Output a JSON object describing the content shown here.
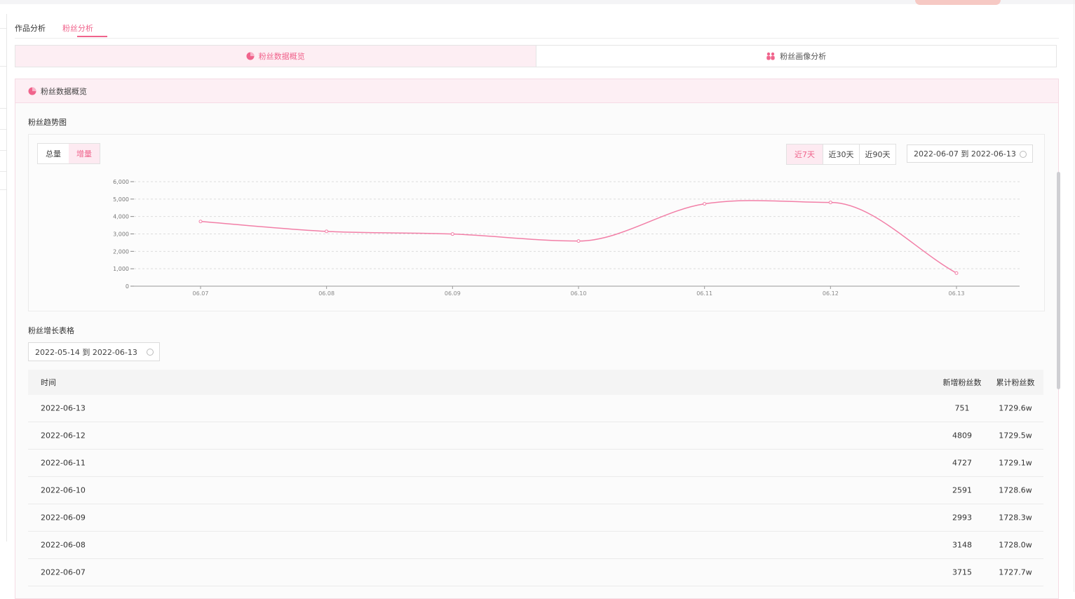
{
  "tabs": [
    {
      "label": "作品分析",
      "active": false
    },
    {
      "label": "粉丝分析",
      "active": true
    }
  ],
  "segment": [
    {
      "label": "粉丝数据概览",
      "icon": "pie-chart-icon",
      "active": true
    },
    {
      "label": "粉丝画像分析",
      "icon": "people-icon",
      "active": false
    }
  ],
  "panel": {
    "title": "粉丝数据概览",
    "icon": "pie-chart-icon"
  },
  "trend": {
    "title": "粉丝趋势图",
    "toggle": [
      {
        "label": "总量",
        "active": false
      },
      {
        "label": "增量",
        "active": true
      }
    ],
    "ranges": [
      {
        "label": "近7天",
        "active": true
      },
      {
        "label": "近30天",
        "active": false
      },
      {
        "label": "近90天",
        "active": false
      }
    ],
    "date_range": "2022-06-07 到 2022-06-13"
  },
  "chart_data": {
    "type": "line",
    "categories": [
      "06.07",
      "06.08",
      "06.09",
      "06.10",
      "06.11",
      "06.12",
      "06.13"
    ],
    "values": [
      3715,
      3148,
      2993,
      2591,
      4727,
      4809,
      751
    ],
    "ylim": [
      0,
      6000
    ],
    "yticks": [
      "6,000",
      "5,000",
      "4,000",
      "3,000",
      "2,000",
      "1,000",
      "0"
    ],
    "grid": true,
    "color": "#f27fa7"
  },
  "growth": {
    "title": "粉丝增长表格",
    "date_range": "2022-05-14 到 2022-06-13",
    "columns": [
      "时间",
      "新增粉丝数",
      "累计粉丝数"
    ],
    "rows": [
      {
        "date": "2022-06-13",
        "new": "751",
        "total": "1729.6w"
      },
      {
        "date": "2022-06-12",
        "new": "4809",
        "total": "1729.5w"
      },
      {
        "date": "2022-06-11",
        "new": "4727",
        "total": "1729.1w"
      },
      {
        "date": "2022-06-10",
        "new": "2591",
        "total": "1728.6w"
      },
      {
        "date": "2022-06-09",
        "new": "2993",
        "total": "1728.3w"
      },
      {
        "date": "2022-06-08",
        "new": "3148",
        "total": "1728.0w"
      },
      {
        "date": "2022-06-07",
        "new": "3715",
        "total": "1727.7w"
      }
    ]
  },
  "colors": {
    "accent": "#f0648c",
    "accent_bg": "#fdeef3"
  }
}
